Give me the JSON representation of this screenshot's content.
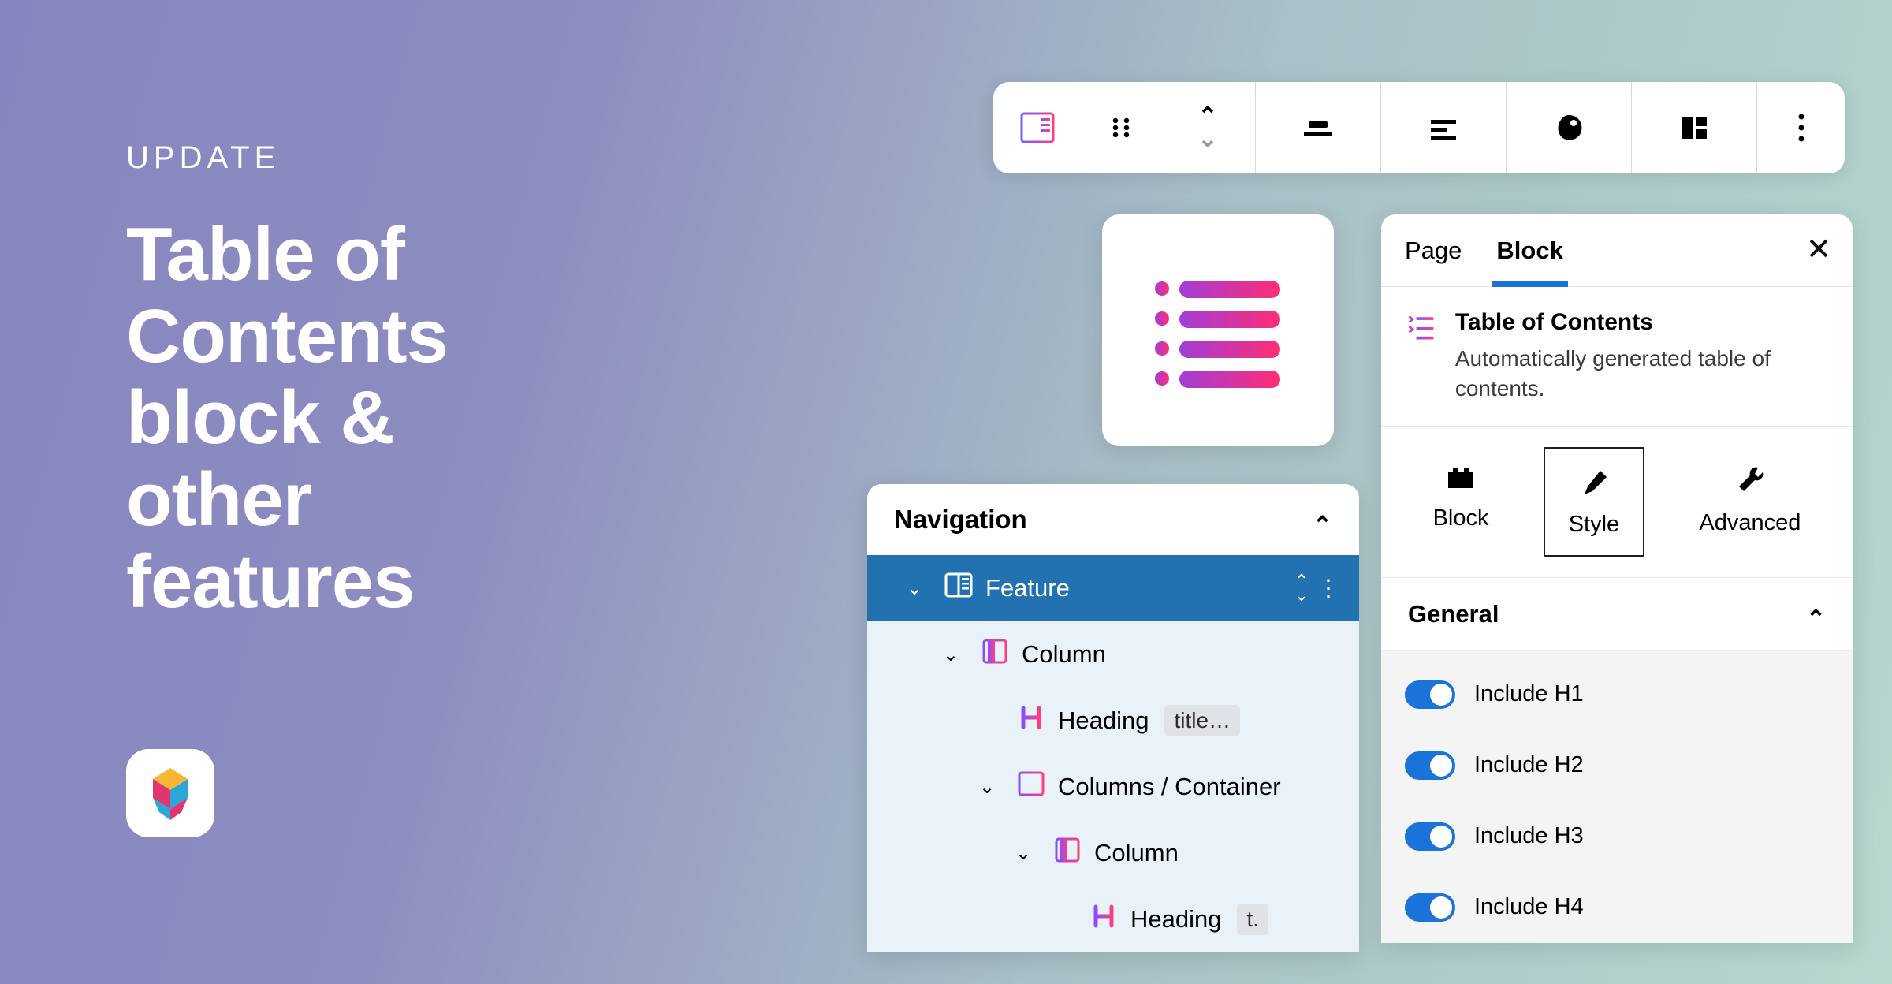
{
  "hero": {
    "eyebrow": "UPDATE",
    "title": "Table of\nContents\nblock &\nother\nfeatures"
  },
  "toolbar": {
    "items": [
      "block-icon",
      "drag-handle",
      "move-up-down",
      "align-center",
      "align-left",
      "color-blob",
      "layout-grid",
      "more"
    ]
  },
  "toc_card": {
    "label": "toc-icon"
  },
  "navigation": {
    "title": "Navigation",
    "rows": [
      {
        "label": "Feature",
        "type": "feature",
        "depth": 0,
        "selected": true,
        "toggle": true
      },
      {
        "label": "Column",
        "type": "column",
        "depth": 1,
        "toggle": true
      },
      {
        "label": "Heading",
        "type": "heading",
        "depth": 2,
        "pill": "title…",
        "toggle": false
      },
      {
        "label": "Columns / Container",
        "type": "columns",
        "depth": 2,
        "toggle": true
      },
      {
        "label": "Column",
        "type": "column",
        "depth": 3,
        "toggle": true
      },
      {
        "label": "Heading",
        "type": "heading",
        "depth": 4,
        "pill": "t.",
        "toggle": false
      }
    ]
  },
  "inspector": {
    "tabs": {
      "page": "Page",
      "block": "Block"
    },
    "block": {
      "name": "Table of Contents",
      "description": "Automatically generated table of contents."
    },
    "modes": {
      "block": "Block",
      "style": "Style",
      "advanced": "Advanced"
    },
    "section_title": "General",
    "toggles": [
      {
        "label": "Include H1"
      },
      {
        "label": "Include H2"
      },
      {
        "label": "Include H3"
      },
      {
        "label": "Include H4"
      }
    ]
  }
}
